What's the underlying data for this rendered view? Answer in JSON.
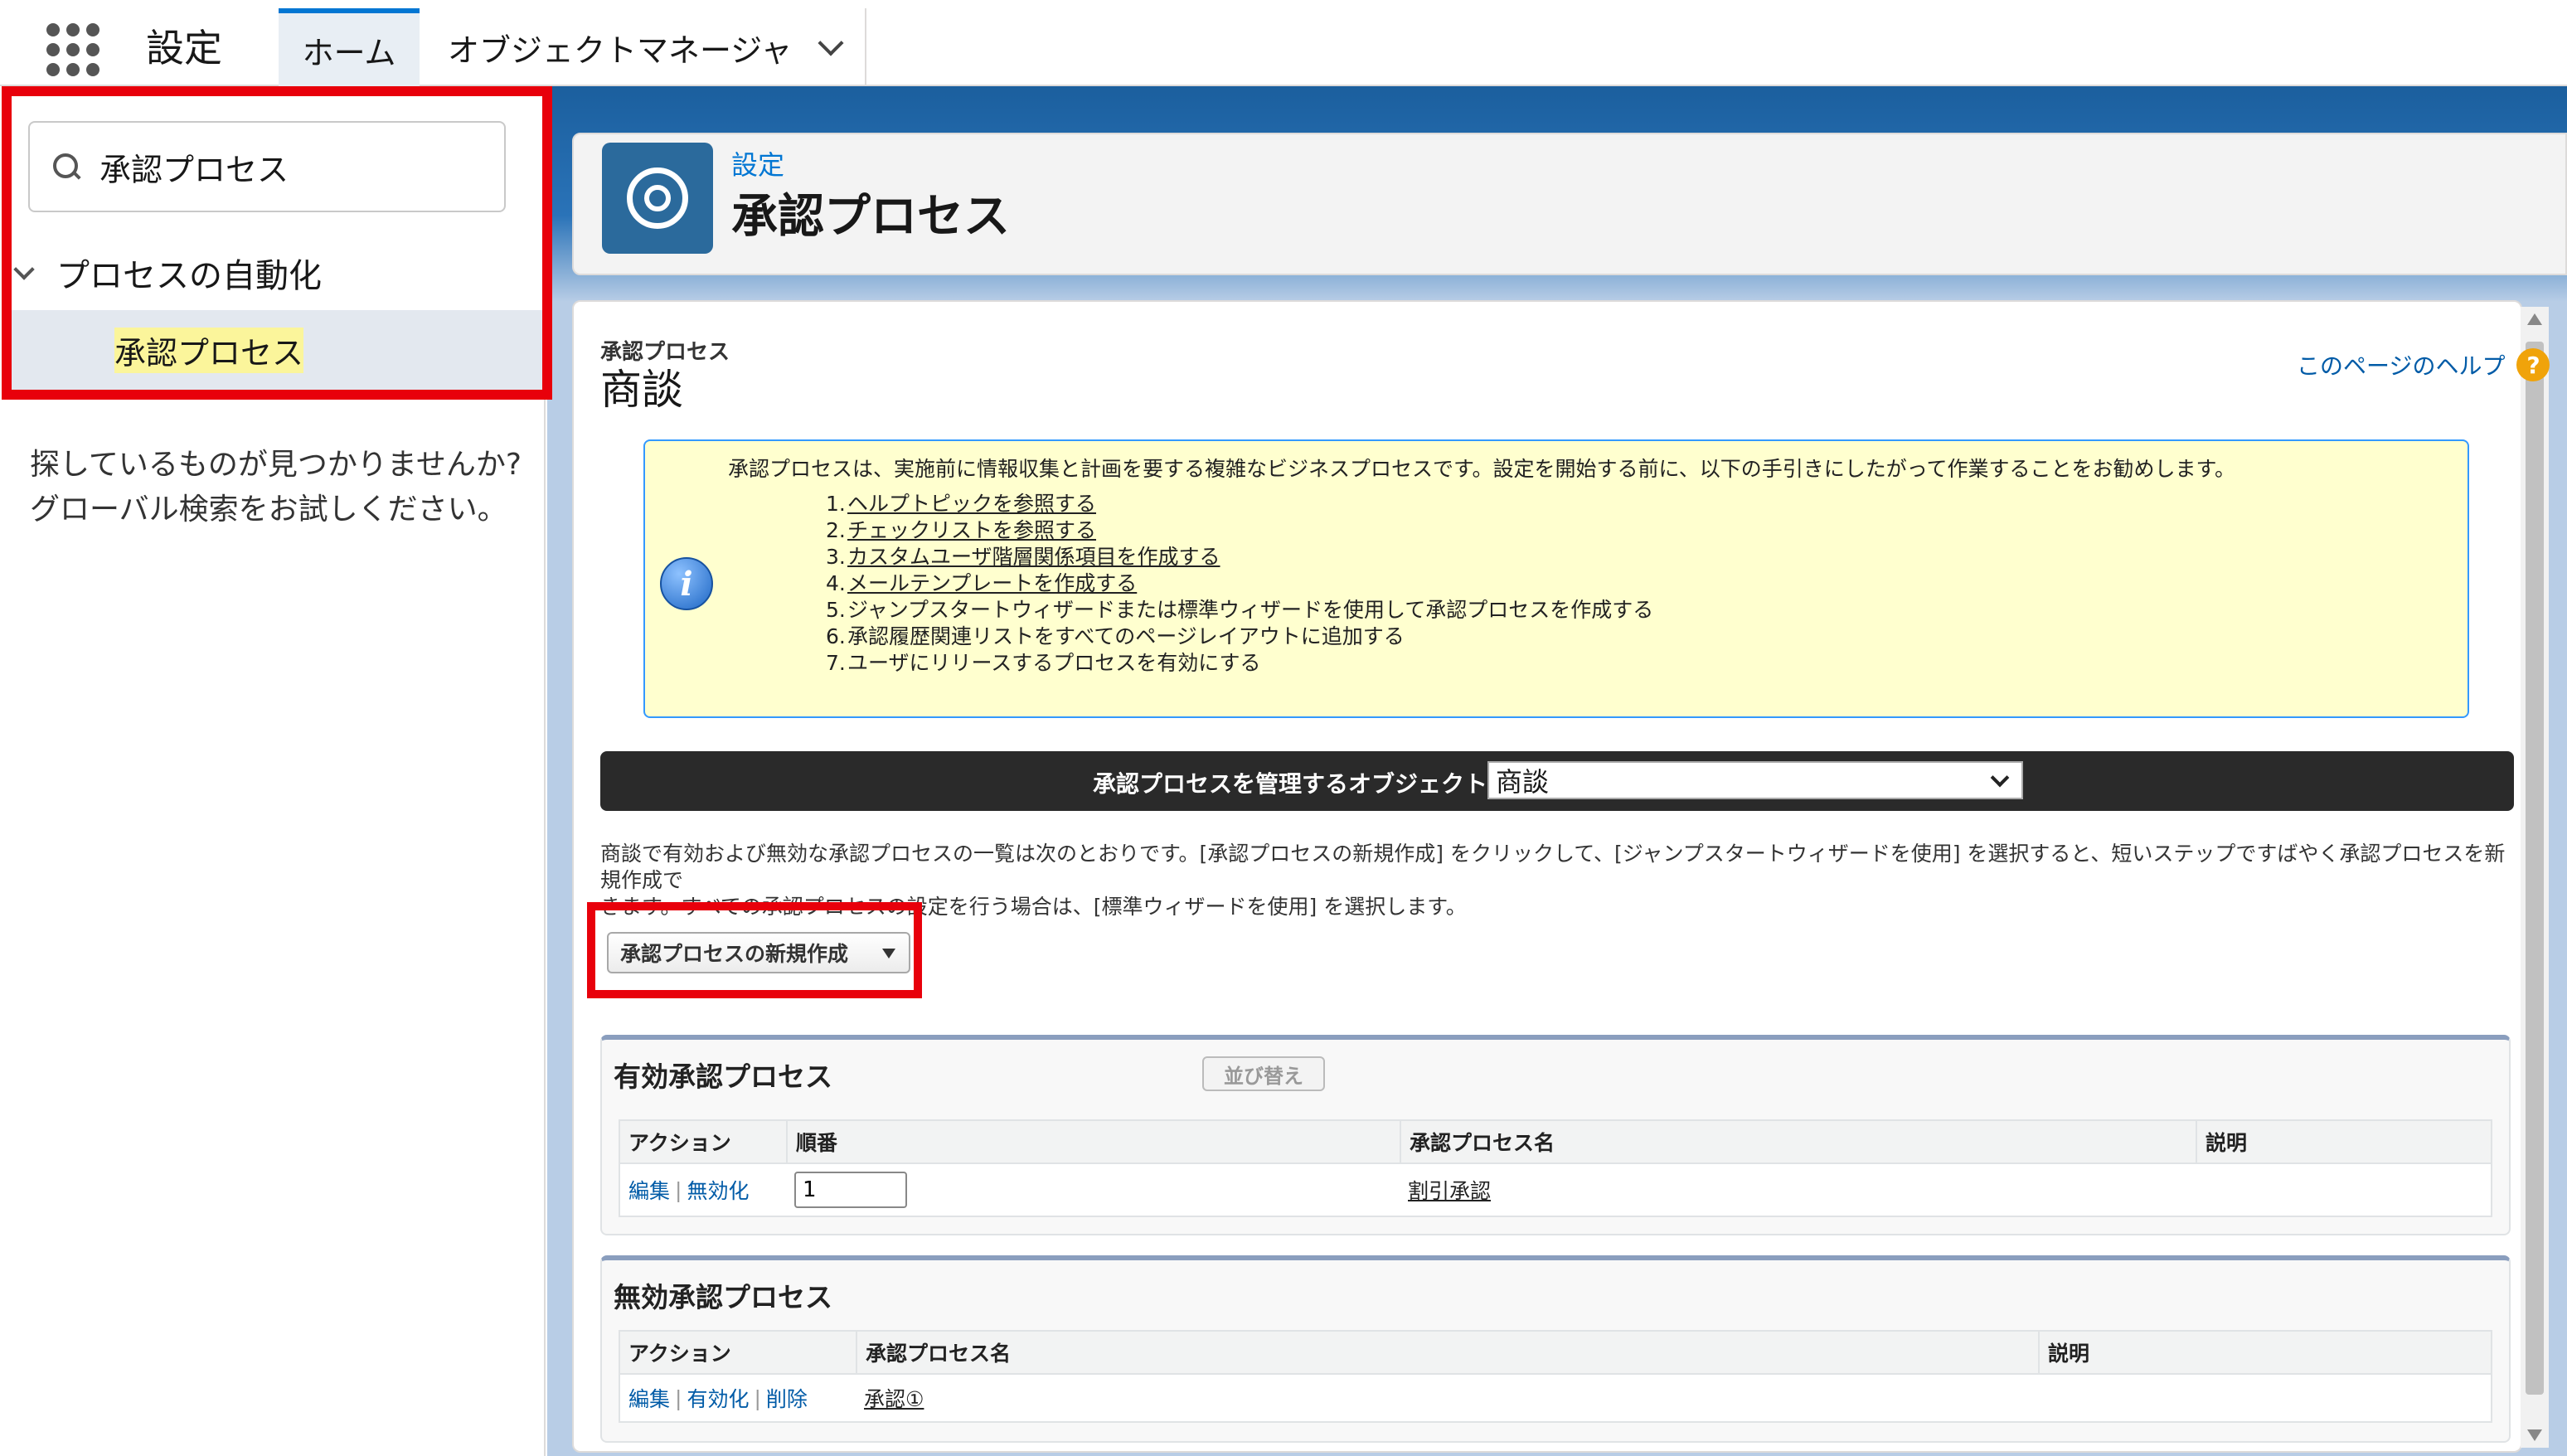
{
  "topbar": {
    "app_title": "設定",
    "tabs": [
      {
        "label": "ホーム"
      },
      {
        "label": "オブジェクトマネージャ"
      }
    ]
  },
  "sidebar": {
    "quickfind_value": "承認プロセス",
    "group_label": "プロセスの自動化",
    "selected_item": "承認プロセス",
    "not_found_line1": "探しているものが見つかりませんか?",
    "not_found_line2": "グローバル検索をお試しください。"
  },
  "header": {
    "breadcrumb": "設定",
    "title": "承認プロセス"
  },
  "page": {
    "subtitle": "承認プロセス",
    "object_name": "商談",
    "help_link": "このページのヘルプ",
    "help_icon": "?"
  },
  "info": {
    "intro": "承認プロセスは、実施前に情報収集と計画を要する複雑なビジネスプロセスです。設定を開始する前に、以下の手引きにしたがって作業することをお勧めします。",
    "steps": [
      {
        "num": "1.",
        "text": "ヘルプトピックを参照する"
      },
      {
        "num": "2.",
        "text": "チェックリストを参照する"
      },
      {
        "num": "3.",
        "text": "カスタムユーザ階層関係項目を作成する"
      },
      {
        "num": "4.",
        "text": "メールテンプレートを作成する"
      },
      {
        "num": "5.",
        "text": "ジャンプスタートウィザードまたは標準ウィザードを使用して承認プロセスを作成する"
      },
      {
        "num": "6.",
        "text": "承認履歴関連リストをすべてのページレイアウトに追加する"
      },
      {
        "num": "7.",
        "text": "ユーザにリリースするプロセスを有効にする"
      }
    ]
  },
  "object_selector": {
    "label": "承認プロセスを管理するオブジェクト:",
    "selected": "商談"
  },
  "description_line1": "商談で有効および無効な承認プロセスの一覧は次のとおりです。[承認プロセスの新規作成] をクリックして、[ジャンプスタートウィザードを使用] を選択すると、短いステップですばやく承認プロセスを新規作成で",
  "description_line2": "きます。すべての承認プロセスの設定を行う場合は、[標準ウィザードを使用] を選択します。",
  "new_button_label": "承認プロセスの新規作成",
  "active_section": {
    "title": "有効承認プロセス",
    "sort_button": "並び替え",
    "columns": {
      "action": "アクション",
      "order": "順番",
      "name": "承認プロセス名",
      "description": "説明"
    },
    "rows": [
      {
        "edit": "編集",
        "deactivate": "無効化",
        "order": "1",
        "name": "割引承認",
        "description": ""
      }
    ]
  },
  "inactive_section": {
    "title": "無効承認プロセス",
    "columns": {
      "action": "アクション",
      "name": "承認プロセス名",
      "description": "説明"
    },
    "rows": [
      {
        "edit": "編集",
        "activate": "有効化",
        "delete": "削除",
        "name": "承認①",
        "description": ""
      }
    ]
  },
  "colors": {
    "accent": "#0176d3",
    "highlight_border": "#e8000b",
    "info_bg": "#ffffcf",
    "link": "#015ba7"
  },
  "icons": [
    "app-launcher-icon",
    "search-icon",
    "chevron-down-icon",
    "gear-icon",
    "help-icon",
    "info-icon"
  ]
}
